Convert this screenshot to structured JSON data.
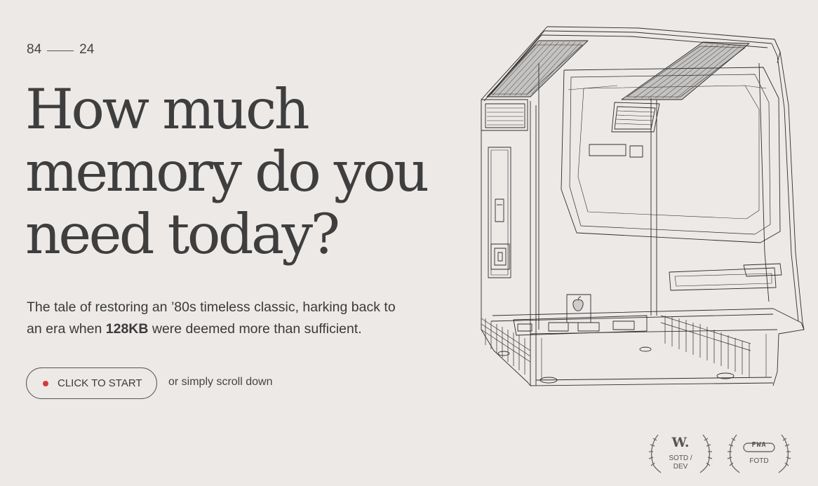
{
  "years": {
    "start": "84",
    "end": "24"
  },
  "hero": {
    "headline_lines": [
      "How much",
      "memory do you",
      "need today?"
    ],
    "tagline_before": "The tale of restoring an ’80s timeless classic, harking back to an era when ",
    "tagline_bold": "128KB",
    "tagline_after": " were deemed more than sufficient."
  },
  "cta": {
    "button_label": "CLICK TO START",
    "scroll_hint": "or simply scroll down"
  },
  "illustration": {
    "icon": "macintosh-wireframe-icon",
    "logo_icon": "apple-logo-icon"
  },
  "awards": [
    {
      "logo": "W.",
      "caption": "SOTD /\nDEV",
      "icon": "laurel-icon"
    },
    {
      "logo": "FWA",
      "caption": "FOTD",
      "icon": "laurel-icon"
    }
  ],
  "colors": {
    "background": "#ece9e7",
    "text": "#3e3e3e",
    "accent_dot": "#d63a3a"
  }
}
